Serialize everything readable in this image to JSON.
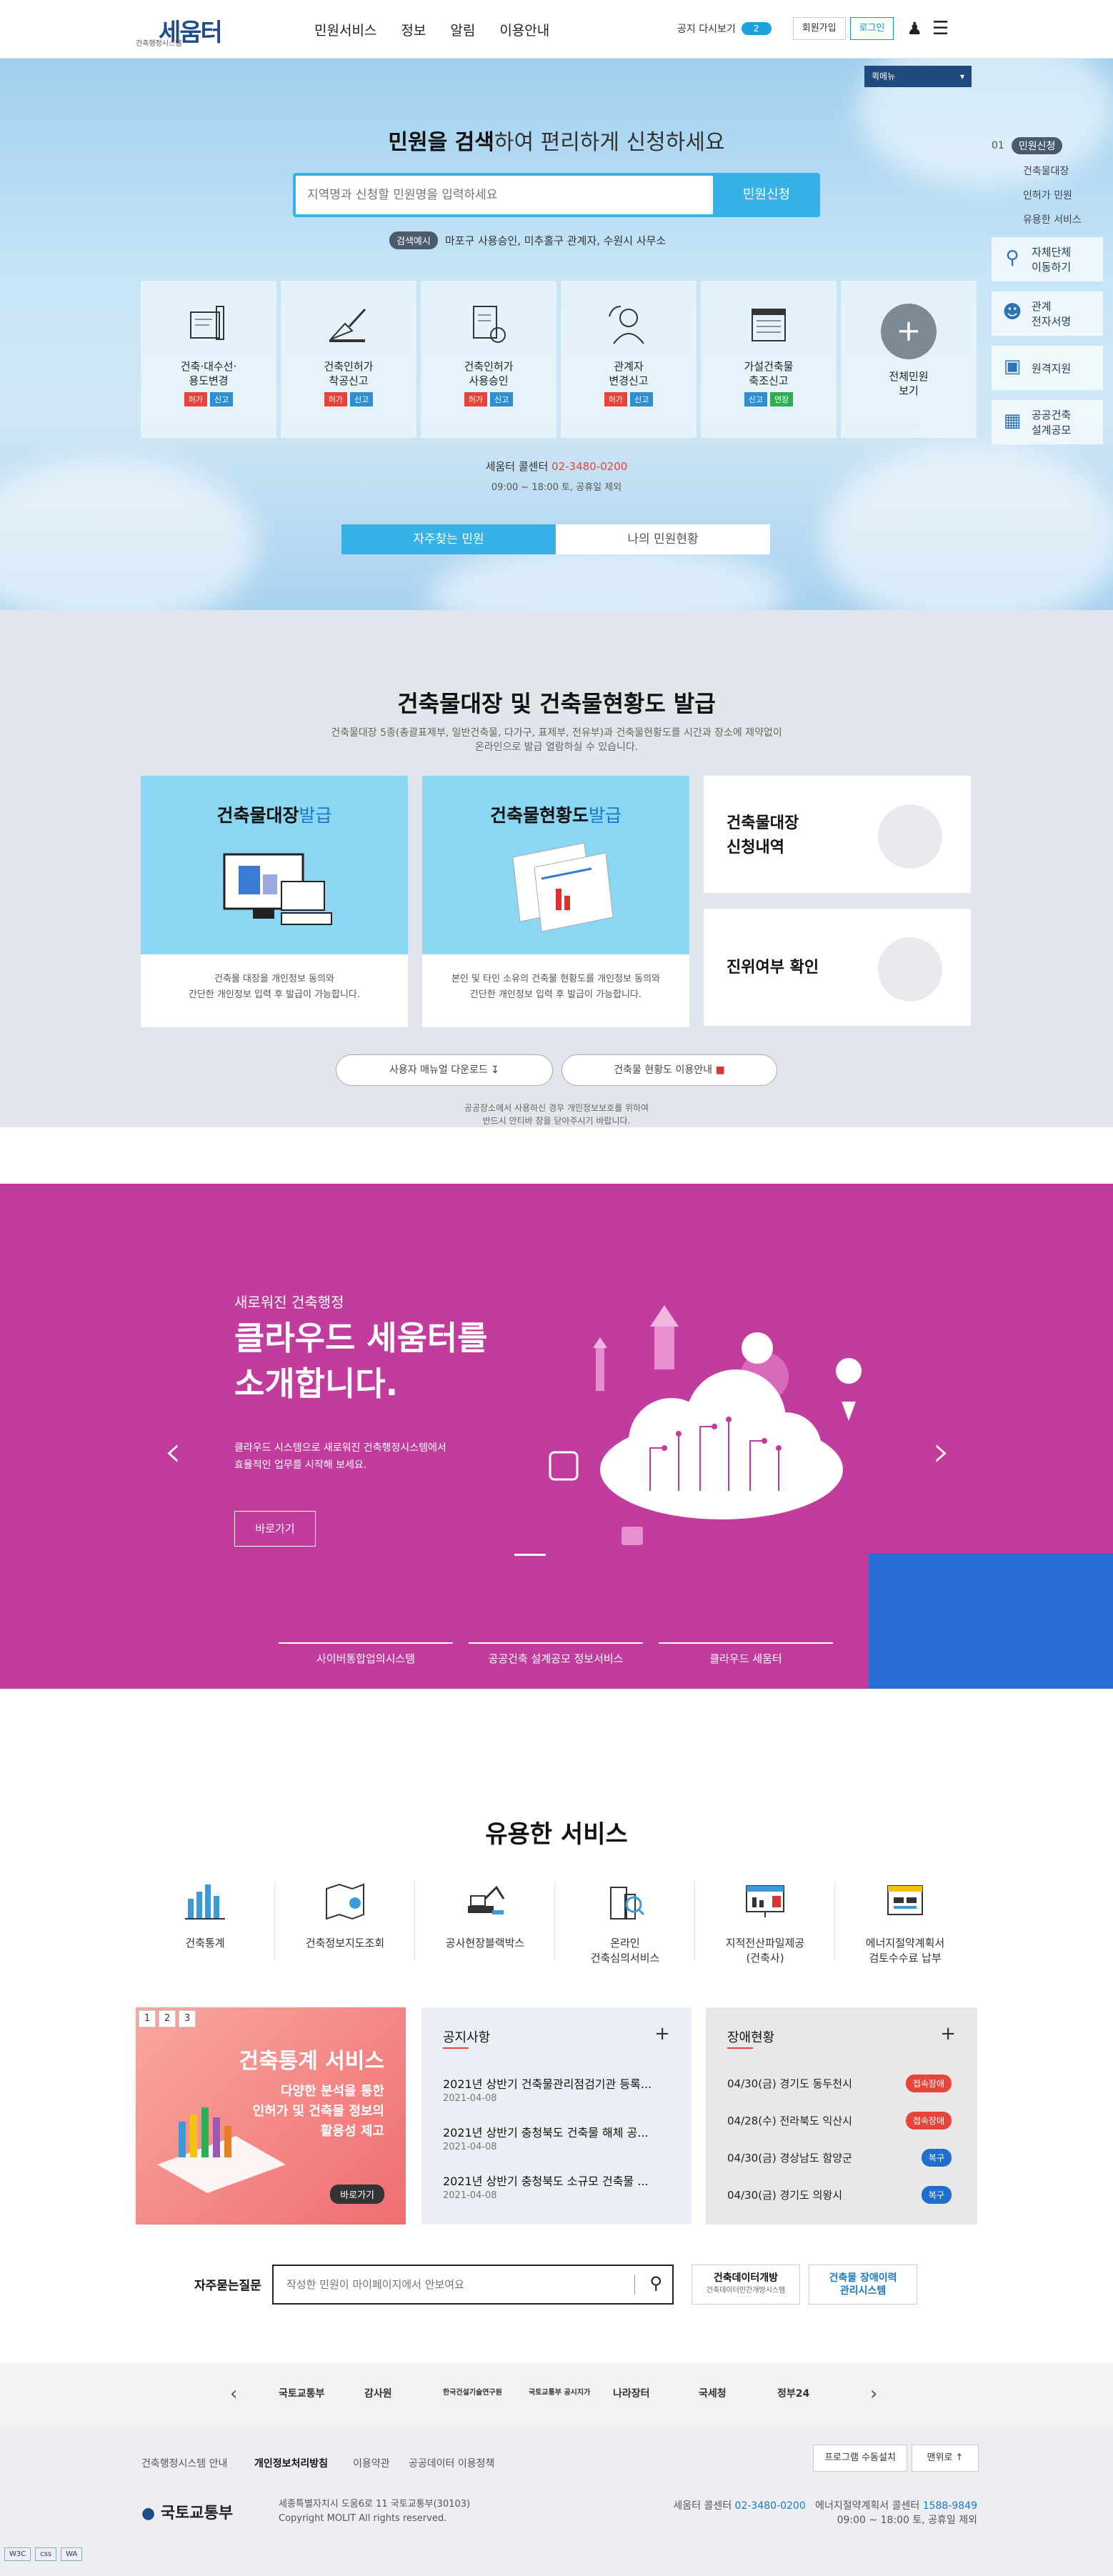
{
  "header": {
    "logo": "세움터",
    "logo_sub": "건축행정시스템",
    "nav": [
      "민원서비스",
      "정보",
      "알림",
      "이용안내"
    ],
    "notice_again": "공지 다시보기",
    "notice_count": "2",
    "join": "회원가입",
    "login": "로그인",
    "my": "my"
  },
  "hero": {
    "quick_menu": "퀵메뉴",
    "title_bold": "민원을 검색",
    "title_rest": "하여 편리하게 신청하세요",
    "search_placeholder": "지역명과 신청할 민원명을 입력하세요",
    "search_button": "민원신청",
    "example_label": "검색예시",
    "example_text": "마포구 사용승인, 미추홀구 관계자, 수원시 사무소",
    "cards": [
      {
        "label1": "건축·대수선·",
        "label2": "용도변경",
        "tags": [
          {
            "t": "허가",
            "c": "r"
          },
          {
            "t": "신고",
            "c": "b"
          }
        ]
      },
      {
        "label1": "건축인허가",
        "label2": "착공신고",
        "tags": [
          {
            "t": "허가",
            "c": "r"
          },
          {
            "t": "신고",
            "c": "b"
          }
        ]
      },
      {
        "label1": "건축인허가",
        "label2": "사용승인",
        "tags": [
          {
            "t": "허가",
            "c": "r"
          },
          {
            "t": "신고",
            "c": "b"
          }
        ]
      },
      {
        "label1": "관계자",
        "label2": "변경신고",
        "tags": [
          {
            "t": "허가",
            "c": "r"
          },
          {
            "t": "신고",
            "c": "b"
          }
        ]
      },
      {
        "label1": "가설건축물",
        "label2": "축조신고",
        "tags": [
          {
            "t": "신고",
            "c": "b"
          },
          {
            "t": "연장",
            "c": "g"
          }
        ]
      }
    ],
    "all_label1": "전체민원",
    "all_label2": "보기",
    "center_label": "세움터 콜센터",
    "center_tel": "02-3480-0200",
    "center_hours": "09:00 ~ 18:00 토, 공휴일 제외",
    "tab_faq": "자주찾는 민원",
    "tab_mine": "나의 민원현황"
  },
  "side": {
    "step_no": "01",
    "step_label": "민원신청",
    "sub": [
      "건축물대장",
      "인허가 민원",
      "유용한 서비스"
    ],
    "boxes": [
      {
        "l1": "자체단체",
        "l2": "이동하기"
      },
      {
        "l1": "관계",
        "l2": "전자서명"
      },
      {
        "l1": "원격지원",
        "l2": ""
      },
      {
        "l1": "공공건축",
        "l2": "설계공모"
      }
    ]
  },
  "registry": {
    "title": "건축물대장 및 건축물현황도 발급",
    "desc1": "건축물대장 5종(총괄표제부, 일반건축물, 다가구, 표제부, 전유부)과 건축물현황도를 시간과 장소에 제약없이",
    "desc2": "온라인으로 발급 열람하실 수 있습니다.",
    "card1_title_b": "건축물대장",
    "card1_title_n": "발급",
    "card1_desc1": "건축물 대장을 개인정보 동의와",
    "card1_desc2": "간단한 개인정보 입력 후 발급이 가능합니다.",
    "card2_title_b": "건축물현황도",
    "card2_title_n": "발급",
    "card2_desc1": "본인 및 타인 소유의 건축물 현황도를 개인정보 동의와",
    "card2_desc2": "간단한 개인정보 입력 후 발급이 가능합니다.",
    "card3_l1": "건축물대장",
    "card3_l2": "신청내역",
    "card4": "진위여부 확인",
    "pill1": "사용자 매뉴얼 다운로드",
    "pill2": "건축물 현황도 이용안내",
    "note1": "공공장소에서 사용하신 경우 개인정보보호를 위하여",
    "note2": "반드시 안티바 창을 닫아주시기 바랍니다."
  },
  "promo": {
    "small": "새로워진 건축행정",
    "title1": "클라우드 세움터를",
    "title2": "소개합니다.",
    "desc1": "클라우드 시스템으로 새로워진 건축행정시스템에서",
    "desc2": "효율적인 업무를 시작해 보세요.",
    "button": "바로가기",
    "tabs": [
      "사이버통합업의시스템",
      "공공건축 설계공모 정보서비스",
      "클라우드 세움터"
    ],
    "prev": "‹",
    "next": "›"
  },
  "services": {
    "title": "유용한 서비스",
    "items": [
      {
        "l1": "건축통계",
        "l2": ""
      },
      {
        "l1": "건축정보지도조회",
        "l2": ""
      },
      {
        "l1": "공사현장블랙박스",
        "l2": ""
      },
      {
        "l1": "온라인",
        "l2": "건축심의서비스"
      },
      {
        "l1": "지적전산파일제공",
        "l2": "(건축사)"
      },
      {
        "l1": "에너지절약계획서",
        "l2": "검토수수료 납부"
      }
    ]
  },
  "banner": {
    "nums": [
      "1",
      "2",
      "3"
    ],
    "title": "건축통계 서비스",
    "desc1": "다양한 분석을 통한",
    "desc2": "인허가 및 건축물 정보의",
    "desc3": "활용성 제고",
    "button": "바로가기"
  },
  "notice": {
    "title": "공지사항",
    "plus": "+",
    "items": [
      {
        "t": "2021년 상반기 건축물관리점검기관 등록...",
        "d": "2021-04-08"
      },
      {
        "t": "2021년 상반기 충청북도 건축물 해체 공...",
        "d": "2021-04-08"
      },
      {
        "t": "2021년 상반기 충청북도 소규모 건축물 ...",
        "d": "2021-04-08"
      }
    ]
  },
  "faults": {
    "title": "장애현황",
    "plus": "+",
    "items": [
      {
        "t": "04/30(금) 경기도 동두천시",
        "b": "접속장애",
        "c": "red"
      },
      {
        "t": "04/28(수) 전라북도 익산시",
        "b": "접속장애",
        "c": "red"
      },
      {
        "t": "04/30(금) 경상남도 함양군",
        "b": "복구",
        "c": "blue"
      },
      {
        "t": "04/30(금) 경기도 의왕시",
        "b": "복구",
        "c": "blue"
      }
    ]
  },
  "faq": {
    "label": "자주묻는질문",
    "placeholder": "작성한 민원이 마이페이지에서 안보여요",
    "link1_l1": "건축데이터개방",
    "link1_l2": "건축데이터민간개방시스템",
    "link2_l1": "건축물 장애이력",
    "link2_l2": "관리시스템"
  },
  "family": [
    "국토교통부",
    "감사원",
    "한국건설기술연구원",
    "국토교통부 공시지가",
    "나라장터",
    "국세청",
    "정부24"
  ],
  "footer": {
    "links": [
      "건축행정시스템 안내",
      "개인정보처리방침",
      "이용약관",
      "공공데이터 이용정책"
    ],
    "btn_install": "프로그램 수동설치",
    "btn_top": "맨위로",
    "logo": "국토교통부",
    "addr": "세종특별자치시 도움6로 11 국토교통부(30103)",
    "copy": "Copyright MOLIT All rights reserved.",
    "call_label": "세움터 콜센터",
    "call_tel": "02-3480-0200",
    "energy_label": "에너지절약계획서 콜센터",
    "energy_tel": "1588-9849",
    "hours": "09:00 ~ 18:00 토, 공휴일 제외",
    "w3c": "W3C",
    "css": "css",
    "wa": "WA"
  }
}
